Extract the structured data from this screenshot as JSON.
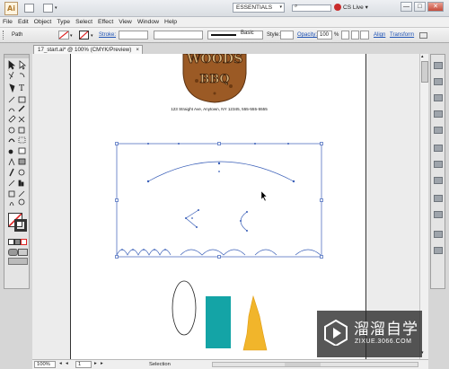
{
  "app": {
    "icon_text": "Ai"
  },
  "workspace": {
    "label": "ESSENTIALS"
  },
  "cs_live": {
    "label": "CS Live"
  },
  "window_controls": {
    "minimize": "—",
    "maximize": "□",
    "close": "✕"
  },
  "menu": [
    "File",
    "Edit",
    "Object",
    "Type",
    "Select",
    "Effect",
    "View",
    "Window",
    "Help"
  ],
  "control_bar": {
    "selection_label": "Path",
    "stroke_label": "Stroke:",
    "brush_label": "Basic",
    "style_label": "Style:",
    "opacity_label": "Opacity:",
    "opacity_value": "100",
    "opacity_unit": "%",
    "align_label": "Align",
    "transform_label": "Transform"
  },
  "document": {
    "tab_title": "17_start.ai* @ 100% (CMYK/Preview)",
    "close": "×"
  },
  "artwork": {
    "logo_text_1": "WOODS",
    "logo_text_2": "BBQ",
    "address": "123 Straight Ave, Anytown, NY 12345, 555-555-5555",
    "accent_teal": "#14a4a6",
    "accent_yellow": "#f1b52b",
    "logo_brown": "#8a4a1f",
    "path_blue": "#3a5fb8"
  },
  "status": {
    "zoom": "100%",
    "page": "1",
    "mode": "Selection"
  },
  "watermark": {
    "brand_cn": "溜溜自学",
    "url": "ZIXUE.3066.COM"
  }
}
